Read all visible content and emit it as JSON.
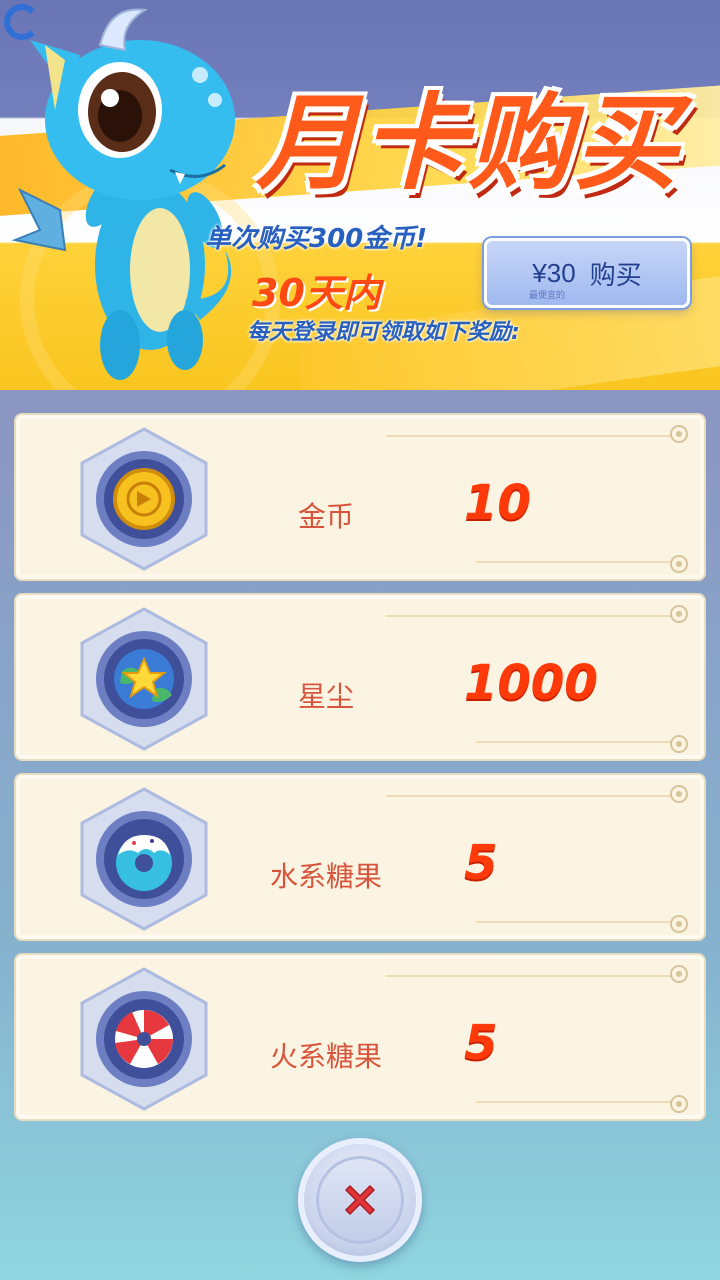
{
  "banner": {
    "title": "月卡购买",
    "line1": "单次购买300金币!",
    "days": "30天内",
    "line3": "每天登录即可领取如下奖励:",
    "buy_price": "¥30",
    "buy_label": "购买",
    "buy_small_text": "最便宜的"
  },
  "rewards": [
    {
      "label": "金币",
      "qty": "10",
      "icon": "gold-coin-icon"
    },
    {
      "label": "星尘",
      "qty": "1000",
      "icon": "stardust-icon"
    },
    {
      "label": "水系糖果",
      "qty": "5",
      "icon": "water-candy-icon"
    },
    {
      "label": "火系糖果",
      "qty": "5",
      "icon": "fire-candy-icon"
    }
  ],
  "close": {
    "icon": "close-icon"
  },
  "colors": {
    "title_orange": "#ff5a1a",
    "promo_blue": "#2860c0",
    "qty_red": "#ff3a0a",
    "card_bg": "#fbf4e2",
    "close_red": "#e0343a"
  }
}
